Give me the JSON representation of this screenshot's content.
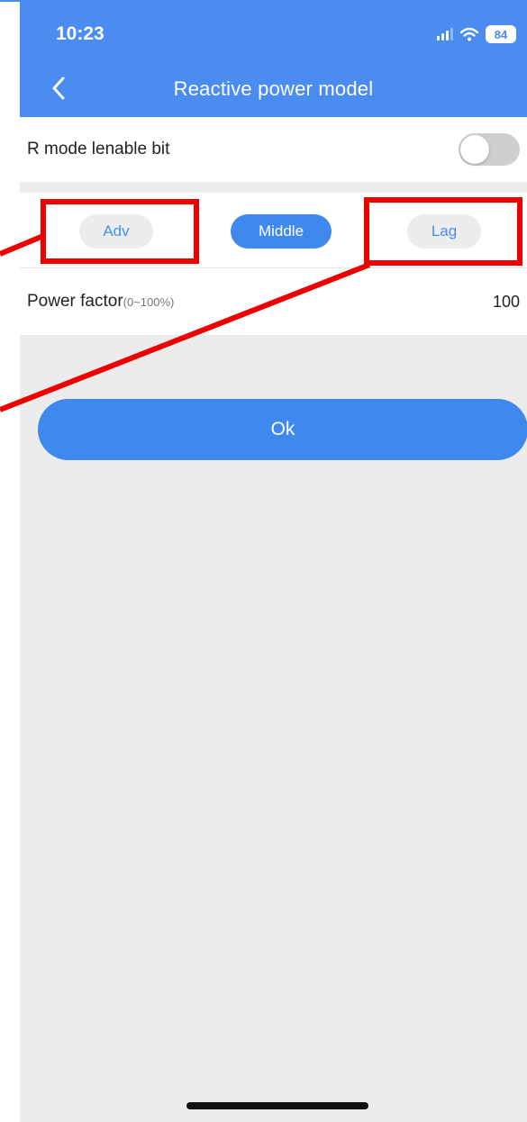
{
  "status_bar": {
    "time": "10:23",
    "battery": "84",
    "icons": [
      "signal-icon",
      "wifi-icon",
      "battery-icon"
    ]
  },
  "nav": {
    "back_icon": "chevron-left-icon",
    "title": "Reactive power model"
  },
  "toggle_row": {
    "label": "R mode lenable bit",
    "enabled": false
  },
  "mode_selector": {
    "options": [
      "Adv",
      "Middle",
      "Lag"
    ],
    "selected": "Middle"
  },
  "power_factor": {
    "label": "Power factor",
    "range": "(0~100%)",
    "value": "100"
  },
  "ok_button": {
    "label": "Ok"
  },
  "colors": {
    "header_blue": "#4a8cf0",
    "button_blue": "#3f88ee",
    "background": "#ececec",
    "annotation_red": "#ee0000"
  }
}
